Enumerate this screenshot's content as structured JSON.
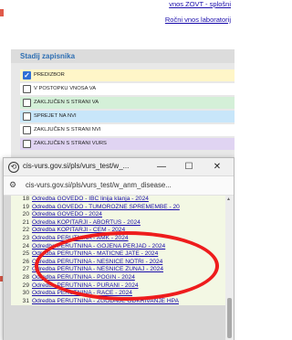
{
  "header_links": [
    "vnos ZOVT - splošni",
    "Ročni vnos laboratorij"
  ],
  "panel": {
    "title": "Stadij zapisnika",
    "statuses": [
      {
        "label": "PREDIZBOR",
        "checked": true,
        "color": "#fff6c8"
      },
      {
        "label": "V POSTOPKU VNOSA VA",
        "checked": false,
        "color": "#ffffff"
      },
      {
        "label": "ZAKLJUČEN S STRANI VA",
        "checked": false,
        "color": "#d4f0d8"
      },
      {
        "label": "SPREJET NA NVI",
        "checked": false,
        "color": "#c8e6fa"
      },
      {
        "label": "ZAKLJUČEN S STRANI NVI",
        "checked": false,
        "color": "#ffffff"
      },
      {
        "label": "ZAKLJUČEN S STRANI VURS",
        "checked": false,
        "color": "#e0d4f2"
      }
    ]
  },
  "popup": {
    "title": "cis-vurs.gov.si/pls/vurs_test/w_...",
    "url": "cis-vurs.gov.si/pls/vurs_test/w_anm_disease...",
    "min_label": "—",
    "max_label": "☐",
    "close_label": "✕",
    "rows": [
      {
        "num": "18",
        "text": "Odredba GOVEDO - IBC linija klanja - 2024"
      },
      {
        "num": "19",
        "text": "Odredba GOVEDO - TUMOROZNE SPREMEMBE - 20"
      },
      {
        "num": "20",
        "text": "Odredba GOVEDO - 2024"
      },
      {
        "num": "21",
        "text": "Odredba KOPITARJI - ABORTUS - 2024"
      },
      {
        "num": "22",
        "text": "Odredba KOPITARJI - CEM - 2024"
      },
      {
        "num": "23",
        "text": "Odredba PERUTNINA - AMK - 2024"
      },
      {
        "num": "24",
        "text": "Odredba PERUTNINA - GOJENA PERJAD - 2024"
      },
      {
        "num": "25",
        "text": "Odredba PERUTNINA - MATIČNE JATE - 2024"
      },
      {
        "num": "26",
        "text": "Odredba PERUTNINA - NESNICE NOTRI - 2024"
      },
      {
        "num": "27",
        "text": "Odredba PERUTNINA - NESNICE ZUNAJ - 2024"
      },
      {
        "num": "28",
        "text": "Odredba PERUTNINA - POGIN - 2024"
      },
      {
        "num": "29",
        "text": "Odredba PERUTNINA - PURANI - 2024"
      },
      {
        "num": "30",
        "text": "Odredba PERUTNINA - RACE - 2024"
      },
      {
        "num": "31",
        "text": "Odredba PERUTNINA - ZGODNJE ODKRIVANJE HPA"
      }
    ]
  }
}
